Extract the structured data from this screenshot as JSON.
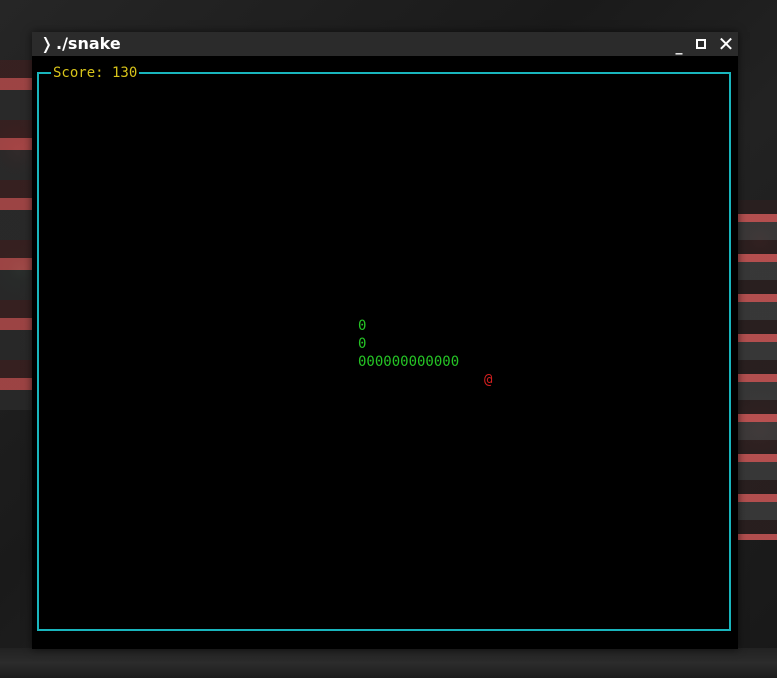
{
  "window": {
    "prompt_glyph": "❭",
    "title": "./snake",
    "minimize_glyph": "_",
    "close_glyph": "✕"
  },
  "game": {
    "score_label": "Score: 130",
    "snake_rows": [
      "0",
      "0",
      "000000000000"
    ],
    "food_glyph": "@"
  },
  "colors": {
    "frame_border": "#19b5bd",
    "score_text": "#d8c41a",
    "snake": "#25c425",
    "food": "#d41f1f",
    "titlebar": "#2b2b2b"
  },
  "icons": [
    "prompt-chevron-icon",
    "minimize-icon",
    "maximize-icon",
    "close-icon"
  ]
}
